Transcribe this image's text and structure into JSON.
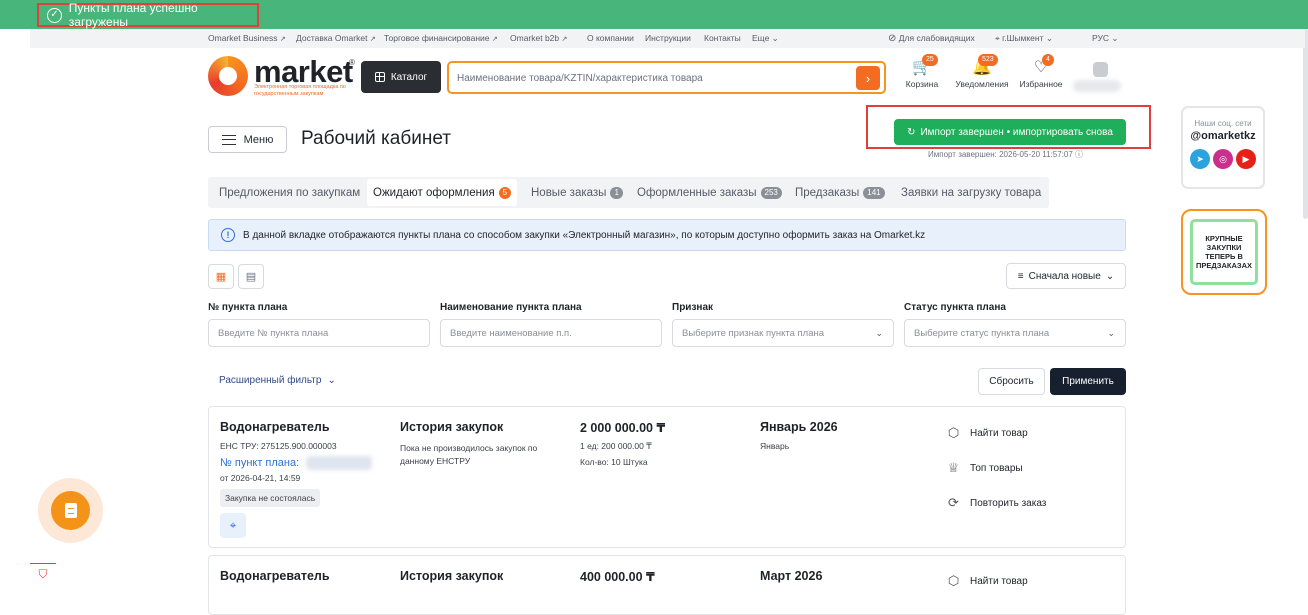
{
  "toast": {
    "text": "Пункты плана успешно загружены"
  },
  "topnav": {
    "links": [
      "Omarket Business",
      "Доставка Omarket",
      "Торговое финансирование",
      "Omarket b2b",
      "О компании",
      "Инструкции",
      "Контакты",
      "Еще"
    ],
    "accessibility": "Для слабовидящих",
    "city": "г.Шымкент",
    "lang": "РУС"
  },
  "header": {
    "logo_word": "market",
    "logo_reg": "®",
    "logo_sub": "Электронная торговая площадка по государственным закупкам",
    "catalog": "Каталог",
    "search_placeholder": "Наименование товара/KZTIN/характеристика товара",
    "cart_label": "Корзина",
    "cart_count": "25",
    "notif_label": "Уведомления",
    "notif_count": "523",
    "fav_label": "Избранное",
    "fav_count": "4"
  },
  "page": {
    "menu": "Меню",
    "title": "Рабочий кабинет",
    "import_btn": "Импорт завершен • импортировать снова",
    "import_note": "Импорт завершен: 2026-05-20 11:57:07"
  },
  "tabs": [
    {
      "label": "Предложения по закупкам",
      "count": ""
    },
    {
      "label": "Ожидают оформления",
      "count": "5"
    },
    {
      "label": "Новые заказы",
      "count": "1"
    },
    {
      "label": "Оформленные заказы",
      "count": "253"
    },
    {
      "label": "Предзаказы",
      "count": "141"
    },
    {
      "label": "Заявки на загрузку товара",
      "count": ""
    }
  ],
  "info": "В данной вкладке отображаются пункты плана со способом закупки «Электронный магазин», по которым доступно оформить заказ на Omarket.kz",
  "sort": "Сначала новые",
  "filters": [
    {
      "label": "№ пункта плана",
      "placeholder": "Введите № пункта плана"
    },
    {
      "label": "Наименование пункта плана",
      "placeholder": "Введите наименование п.п."
    },
    {
      "label": "Признак",
      "placeholder": "Выберите признак пункта плана"
    },
    {
      "label": "Статус пункта плана",
      "placeholder": "Выберите статус пункта плана"
    }
  ],
  "advanced_filter": "Расширенный фильтр",
  "reset": "Сбросить",
  "apply": "Применить",
  "cards": [
    {
      "name": "Водонагреватель",
      "ens": "ЕНС ТРУ: 275125.900.000003",
      "num_label": "№ пункт плана:",
      "date": "от 2026-04-21, 14:59",
      "status": "Закупка не состоялась",
      "history_title": "История закупок",
      "history_desc": "Пока не производилось закупок по данному ЕНСТРУ",
      "price": "2 000 000.00 ₸",
      "unit_price": "1 ед: 200 000.00 ₸",
      "qty": "Кол-во: 10 Штука",
      "month": "Январь 2026",
      "month_short": "Январь",
      "actions": [
        "Найти товар",
        "Топ товары",
        "Повторить заказ"
      ]
    },
    {
      "name": "Водонагреватель",
      "history_title": "История закупок",
      "price": "400 000.00 ₸",
      "month": "Март 2026",
      "actions": [
        "Найти товар"
      ]
    }
  ],
  "social": {
    "caption": "Наши соц. сети",
    "handle": "@omarketkz"
  },
  "promo": "КРУПНЫЕ ЗАКУПКИ ТЕПЕРЬ В ПРЕДЗАКАЗАХ",
  "colors": {
    "accent": "#f36c21",
    "success": "#1fae5a",
    "toast": "#48b57a",
    "dark": "#17202e",
    "link": "#2f6fd6"
  }
}
